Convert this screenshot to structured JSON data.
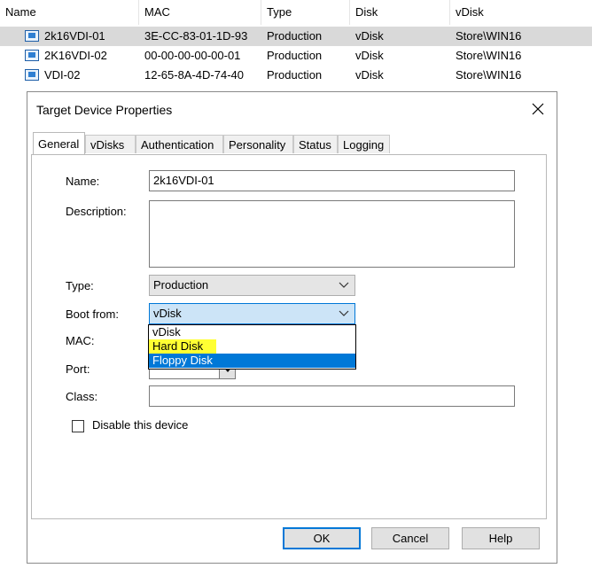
{
  "list": {
    "columns": [
      "Name",
      "MAC",
      "Type",
      "Disk",
      "vDisk"
    ],
    "rows": [
      {
        "name": "2k16VDI-01",
        "mac": "3E-CC-83-01-1D-93",
        "type": "Production",
        "disk": "vDisk",
        "vdisk": "Store\\WIN16"
      },
      {
        "name": "2K16VDI-02",
        "mac": "00-00-00-00-00-01",
        "type": "Production",
        "disk": "vDisk",
        "vdisk": "Store\\WIN16"
      },
      {
        "name": "VDI-02",
        "mac": "12-65-8A-4D-74-40",
        "type": "Production",
        "disk": "vDisk",
        "vdisk": "Store\\WIN16"
      }
    ]
  },
  "dialog": {
    "title": "Target Device Properties",
    "tabs": [
      "General",
      "vDisks",
      "Authentication",
      "Personality",
      "Status",
      "Logging"
    ],
    "active_tab": "General",
    "fields": {
      "name_label": "Name:",
      "name_value": "2k16VDI-01",
      "description_label": "Description:",
      "description_value": "",
      "type_label": "Type:",
      "type_value": "Production",
      "boot_label": "Boot from:",
      "boot_value": "vDisk",
      "boot_options": [
        "vDisk",
        "Hard Disk",
        "Floppy Disk"
      ],
      "mac_label": "MAC:",
      "port_label": "Port:",
      "class_label": "Class:",
      "class_value": "",
      "disable_label": "Disable this device"
    },
    "buttons": {
      "ok": "OK",
      "cancel": "Cancel",
      "help": "Help"
    }
  },
  "colors": {
    "selection": "#0078d7",
    "highlight": "#ffff33",
    "focus_fill": "#cce4f7"
  }
}
